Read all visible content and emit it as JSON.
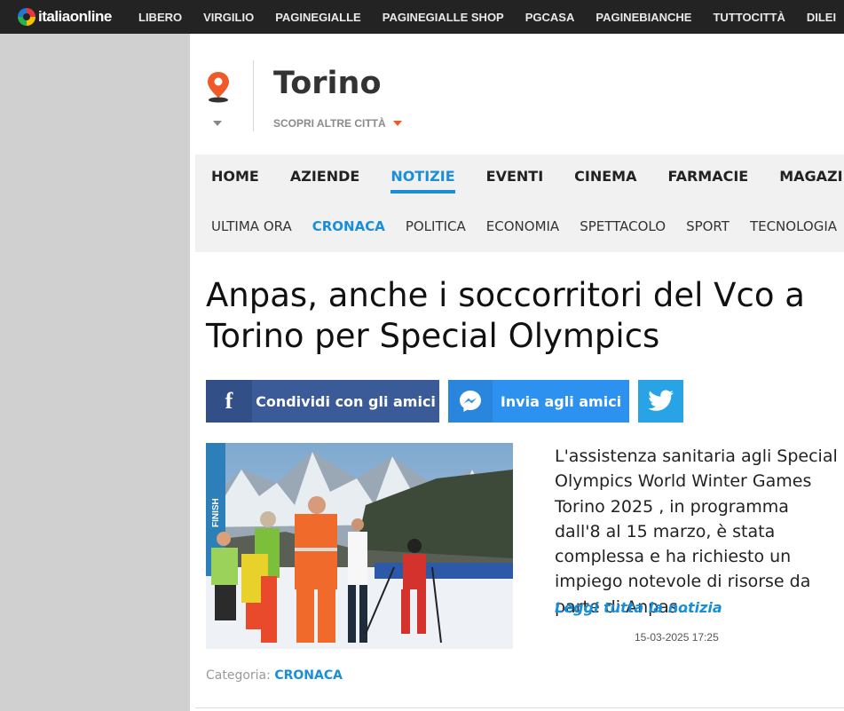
{
  "topbar": {
    "logo_italia": "italia",
    "logo_online": "online",
    "links": [
      "LIBERO",
      "VIRGILIO",
      "PAGINEGIALLE",
      "PAGINEGIALLE SHOP",
      "PGCASA",
      "PAGINEBIANCHE",
      "TUTTOCITTÀ",
      "DILEI"
    ]
  },
  "city": {
    "name": "Torino",
    "discover_label": "SCOPRI ALTRE CITTÀ"
  },
  "main_nav": {
    "items": [
      "HOME",
      "AZIENDE",
      "NOTIZIE",
      "EVENTI",
      "CINEMA",
      "FARMACIE",
      "MAGAZINE"
    ],
    "active": "NOTIZIE"
  },
  "sub_nav": {
    "items": [
      "ULTIMA ORA",
      "CRONACA",
      "POLITICA",
      "ECONOMIA",
      "SPETTACOLO",
      "SPORT",
      "TECNOLOGIA"
    ],
    "active": "CRONACA"
  },
  "article": {
    "title": "Anpas, anche i soccorritori del Vco a Torino per Special Olympics",
    "excerpt": "L'assistenza sanitaria agli Special Olympics World Winter Games Torino 2025 , in programma dall'8 al 15 marzo, è stata complessa e ha richiesto un impiego notevole di risorse da parte di Anpas",
    "ellipsis": "...",
    "read_more": "Leggi tutta la notizia",
    "date": "15-03-2025 17:25",
    "category_label": "Categoria:",
    "category": "CRONACA",
    "photo_banner_text": "FINISH"
  },
  "share": {
    "facebook_label": "Condividi con gli amici",
    "messenger_label": "Invia agli amici"
  },
  "colors": {
    "accent": "#1a8fd9",
    "topbar": "#232323",
    "facebook": "#3b5a98",
    "messenger": "#2d91ef",
    "twitter": "#27a3e6",
    "pin": "#f05a28"
  },
  "icons": {
    "location": "map-pin-icon",
    "facebook": "facebook-icon",
    "messenger": "messenger-icon",
    "twitter": "twitter-bird-icon"
  }
}
